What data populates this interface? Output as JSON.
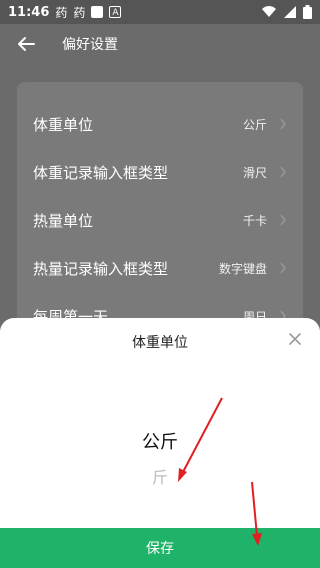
{
  "status_bar": {
    "time": "11:46",
    "app_icon_1": "药",
    "app_icon_2": "药",
    "icons": [
      "app-icon",
      "app-icon",
      "square-icon",
      "a-icon",
      "wifi-icon",
      "signal-icon",
      "battery-icon"
    ]
  },
  "header": {
    "title": "偏好设置",
    "back_icon": "back-arrow-icon"
  },
  "settings": {
    "rows": [
      {
        "label": "体重单位",
        "value": "公斤"
      },
      {
        "label": "体重记录输入框类型",
        "value": "滑尺"
      },
      {
        "label": "热量单位",
        "value": "千卡"
      },
      {
        "label": "热量记录输入框类型",
        "value": "数字键盘"
      },
      {
        "label": "每周第一天",
        "value": "周日"
      }
    ]
  },
  "sheet": {
    "title": "体重单位",
    "selected_option": "公斤",
    "other_option": "斤",
    "save_label": "保存"
  },
  "colors": {
    "accent": "#1fb36a",
    "annotation_arrow": "#e02020"
  }
}
